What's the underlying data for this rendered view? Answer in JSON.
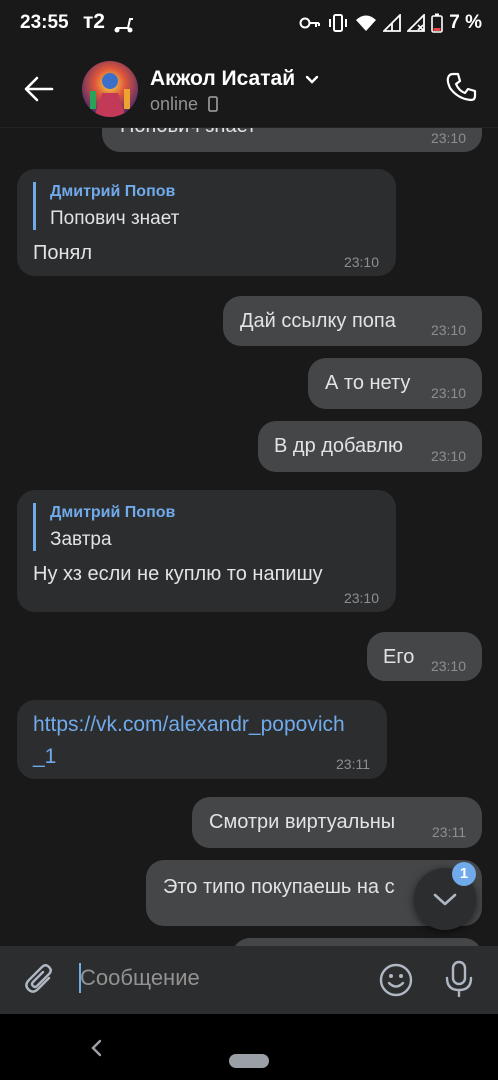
{
  "status_bar": {
    "time": "23:55",
    "carrier": "т2",
    "battery": "7 %"
  },
  "header": {
    "contact_name": "Акжол Исатай",
    "status": "online"
  },
  "messages": [
    {
      "text": "Попович знает",
      "time": "23:10"
    },
    {
      "quote_author": "Дмитрий Попов",
      "quote_text": "Попович знает",
      "text": "Понял",
      "time": "23:10"
    },
    {
      "text": "Дай ссылку попа",
      "time": "23:10"
    },
    {
      "text": "А то нету",
      "time": "23:10"
    },
    {
      "text": "В др добавлю",
      "time": "23:10"
    },
    {
      "quote_author": "Дмитрий Попов",
      "quote_text": "Завтра",
      "text": "Ну хз если не куплю то напишу",
      "time": "23:10"
    },
    {
      "text": "Его",
      "time": "23:10"
    },
    {
      "link_line1": "https://vk.com/alexandr_popovich",
      "link_line2": "_1",
      "time": "23:11"
    },
    {
      "text": "Смотри виртуальны",
      "time": "23:11"
    },
    {
      "text": "Это типо покупаешь на с"
    }
  ],
  "scroll_down": {
    "unread": "1"
  },
  "composer": {
    "placeholder": "Сообщение"
  },
  "colors": {
    "background": "#19191a",
    "incoming": "#2c2d2e",
    "outgoing": "#454647",
    "accent": "#71aaeb"
  }
}
